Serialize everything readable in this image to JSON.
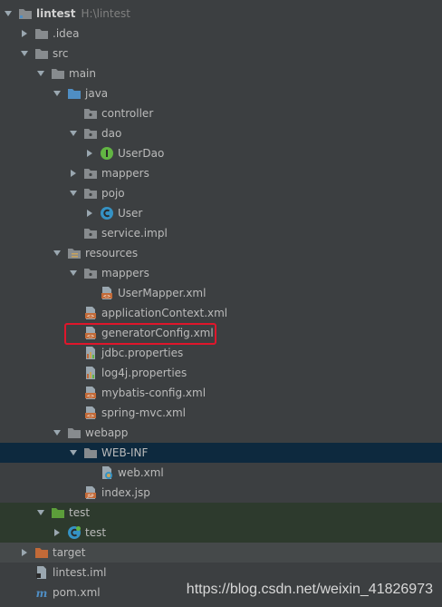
{
  "tree": {
    "root_label": "lintest",
    "root_path": "H:\\lintest",
    "items": [
      {
        "label": "lintest"
      },
      {
        "label": ".idea"
      },
      {
        "label": "src"
      },
      {
        "label": "main"
      },
      {
        "label": "java"
      },
      {
        "label": "controller"
      },
      {
        "label": "dao"
      },
      {
        "label": "UserDao"
      },
      {
        "label": "mappers"
      },
      {
        "label": "pojo"
      },
      {
        "label": "User"
      },
      {
        "label": "service.impl"
      },
      {
        "label": "resources"
      },
      {
        "label": "mappers"
      },
      {
        "label": "UserMapper.xml"
      },
      {
        "label": "applicationContext.xml"
      },
      {
        "label": "generatorConfig.xml"
      },
      {
        "label": "jdbc.properties"
      },
      {
        "label": "log4j.properties"
      },
      {
        "label": "mybatis-config.xml"
      },
      {
        "label": "spring-mvc.xml"
      },
      {
        "label": "webapp"
      },
      {
        "label": "WEB-INF"
      },
      {
        "label": "web.xml"
      },
      {
        "label": "index.jsp"
      },
      {
        "label": "test"
      },
      {
        "label": "test"
      },
      {
        "label": "target"
      },
      {
        "label": "lintest.iml"
      },
      {
        "label": "pom.xml"
      }
    ]
  },
  "watermark": "https://blog.csdn.net/weixin_41826973",
  "colors": {
    "folder": "#878b8e",
    "source_folder": "#4f8ec4",
    "test_folder": "#5c9e3a",
    "excluded_folder": "#c26a38",
    "interface": "#62b543",
    "class": "#3592c4",
    "xml": "#c26a38",
    "highlight_box": "#e0162b"
  }
}
